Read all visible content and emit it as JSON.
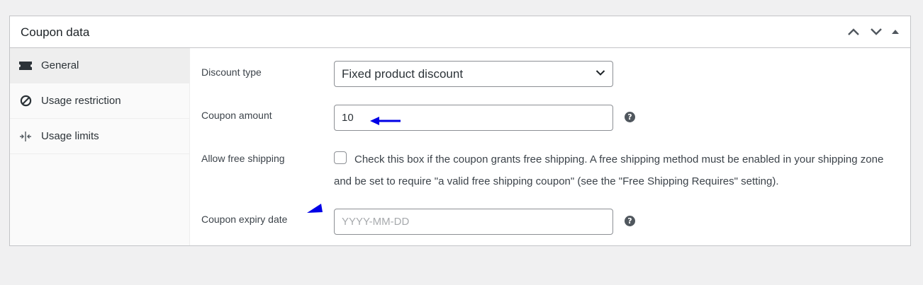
{
  "panel": {
    "title": "Coupon data"
  },
  "header_controls": [
    {
      "name": "move-up",
      "icon": "chevron-up-icon"
    },
    {
      "name": "move-down",
      "icon": "chevron-down-icon"
    },
    {
      "name": "toggle",
      "icon": "triangle-up-icon"
    }
  ],
  "sidebar": {
    "items": [
      {
        "label": "General",
        "icon": "ticket-icon",
        "active": true
      },
      {
        "label": "Usage restriction",
        "icon": "block-icon",
        "active": false
      },
      {
        "label": "Usage limits",
        "icon": "limits-icon",
        "active": false
      }
    ]
  },
  "form": {
    "discount_type": {
      "label": "Discount type",
      "value": "Fixed product discount"
    },
    "coupon_amount": {
      "label": "Coupon amount",
      "value": "10",
      "help": "?"
    },
    "free_shipping": {
      "label": "Allow free shipping",
      "checked": false,
      "description": "Check this box if the coupon grants free shipping. A free shipping method must be enabled in your shipping zone and be set to require \"a valid free shipping coupon\" (see the \"Free Shipping Requires\" setting)."
    },
    "expiry_date": {
      "label": "Coupon expiry date",
      "value": "",
      "placeholder": "YYYY-MM-DD",
      "help": "?"
    }
  },
  "colors": {
    "annotation": "#0000e6",
    "help_icon": "#50575e",
    "border": "#c3c4c7"
  }
}
